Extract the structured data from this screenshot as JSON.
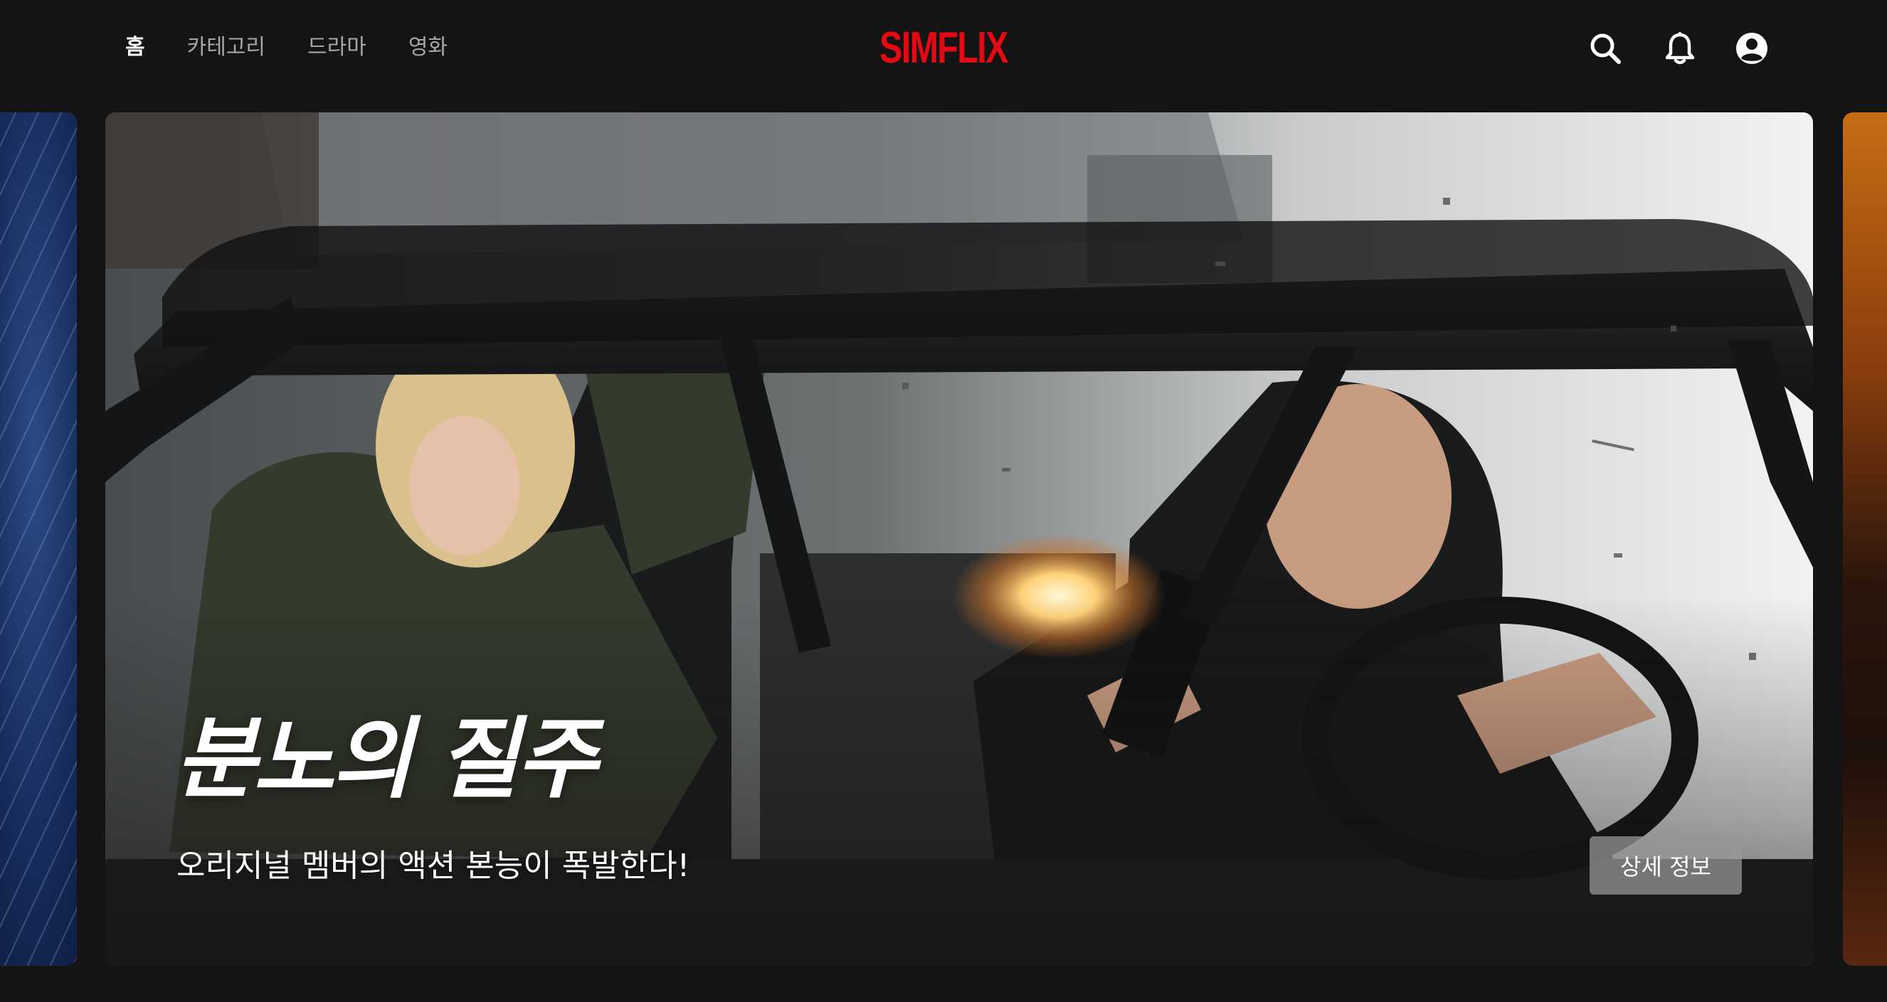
{
  "header": {
    "nav": [
      {
        "label": "홈",
        "active": true
      },
      {
        "label": "카테고리",
        "active": false
      },
      {
        "label": "드라마",
        "active": false
      },
      {
        "label": "영화",
        "active": false
      }
    ],
    "logo": "SIMFLIX",
    "icons": [
      "search-icon",
      "bell-icon",
      "profile-icon"
    ]
  },
  "hero": {
    "title": "분노의 질주",
    "subtitle": "오리지널 멤버의 액션 본능이 폭발한다!",
    "detail_button": "상세 정보"
  },
  "colors": {
    "background": "#141414",
    "logo_red": "#e50914",
    "nav_inactive": "#a7a7a7",
    "nav_active": "#ffffff"
  }
}
